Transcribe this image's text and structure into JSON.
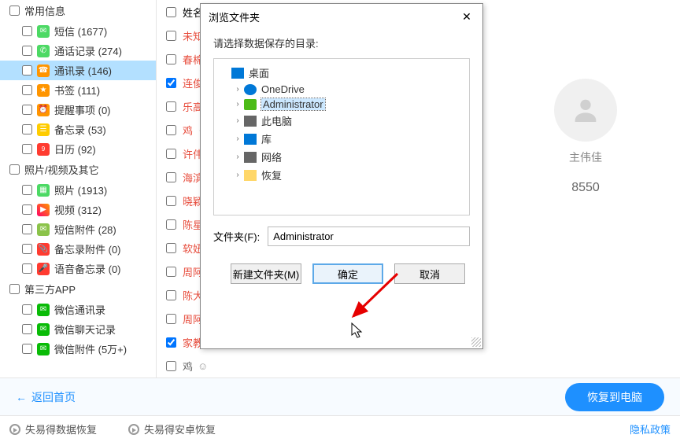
{
  "sidebar": {
    "sections": [
      {
        "title": "常用信息",
        "items": [
          {
            "label": "短信 (1677)",
            "icon": "ic-sms"
          },
          {
            "label": "通话记录 (274)",
            "icon": "ic-call"
          },
          {
            "label": "通讯录 (146)",
            "icon": "ic-contacts",
            "selected": true
          },
          {
            "label": "书签 (111)",
            "icon": "ic-bookmark"
          },
          {
            "label": "提醒事项 (0)",
            "icon": "ic-reminder"
          },
          {
            "label": "备忘录 (53)",
            "icon": "ic-notes"
          },
          {
            "label": "日历 (92)",
            "icon": "ic-cal"
          }
        ]
      },
      {
        "title": "照片/视频及其它",
        "items": [
          {
            "label": "照片 (1913)",
            "icon": "ic-photo"
          },
          {
            "label": "视频 (312)",
            "icon": "ic-video"
          },
          {
            "label": "短信附件 (28)",
            "icon": "ic-smsatt"
          },
          {
            "label": "备忘录附件 (0)",
            "icon": "ic-noteatt"
          },
          {
            "label": "语音备忘录 (0)",
            "icon": "ic-voiceatt"
          }
        ]
      },
      {
        "title": "第三方APP",
        "items": [
          {
            "label": "微信通讯录",
            "icon": "ic-wechat"
          },
          {
            "label": "微信聊天记录",
            "icon": "ic-wechat"
          },
          {
            "label": "微信附件 (5万+)",
            "icon": "ic-wechat"
          }
        ]
      }
    ]
  },
  "main": {
    "header": "姓名",
    "rows": [
      {
        "label": "未知",
        "red": true,
        "checked": false
      },
      {
        "label": "春棉",
        "red": true,
        "checked": false
      },
      {
        "label": "连俊",
        "red": true,
        "checked": true
      },
      {
        "label": "乐高",
        "red": true,
        "checked": false
      },
      {
        "label": "鸡",
        "red": true,
        "checked": false,
        "extra": "☺"
      },
      {
        "label": "许伟",
        "red": true,
        "checked": false
      },
      {
        "label": "海滨",
        "red": true,
        "checked": false
      },
      {
        "label": "晓颖",
        "red": true,
        "checked": false
      },
      {
        "label": "陈星",
        "red": true,
        "checked": false
      },
      {
        "label": "软妞",
        "red": true,
        "checked": false
      },
      {
        "label": "周阿",
        "red": true,
        "checked": false
      },
      {
        "label": "陈大",
        "red": true,
        "checked": false
      },
      {
        "label": "周阿",
        "red": true,
        "checked": false
      },
      {
        "label": "家教",
        "red": true,
        "checked": true
      },
      {
        "label": "鸡",
        "red": false,
        "checked": false,
        "extra": "☺"
      }
    ]
  },
  "detail": {
    "name": "主伟佳",
    "value": "8550"
  },
  "bottom": {
    "back": "返回首页",
    "restore": "恢复到电脑"
  },
  "footer": {
    "item1": "失易得数据恢复",
    "item2": "失易得安卓恢复",
    "privacy": "隐私政策"
  },
  "dialog": {
    "title": "浏览文件夹",
    "instruction": "请选择数据保存的目录:",
    "tree": [
      {
        "label": "桌面",
        "icon": "ticon-desktop",
        "depth": 0
      },
      {
        "label": "OneDrive",
        "icon": "ticon-onedrive",
        "depth": 1,
        "chev": "›"
      },
      {
        "label": "Administrator",
        "icon": "ticon-user",
        "depth": 1,
        "chev": "›",
        "selected": true
      },
      {
        "label": "此电脑",
        "icon": "ticon-pc",
        "depth": 1,
        "chev": "›"
      },
      {
        "label": "库",
        "icon": "ticon-lib",
        "depth": 1,
        "chev": "›"
      },
      {
        "label": "网络",
        "icon": "ticon-net",
        "depth": 1,
        "chev": "›"
      },
      {
        "label": "恢复",
        "icon": "ticon-folder",
        "depth": 1,
        "chev": "›"
      }
    ],
    "folder_label": "文件夹(F):",
    "folder_value": "Administrator",
    "btn_new": "新建文件夹(M)",
    "btn_ok": "确定",
    "btn_cancel": "取消"
  }
}
